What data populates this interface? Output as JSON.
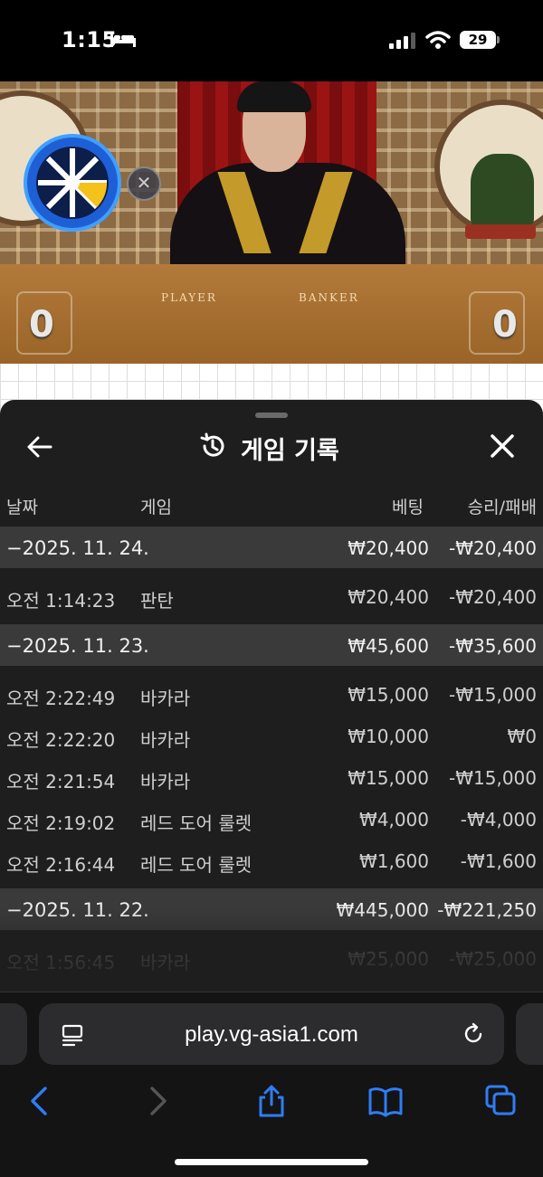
{
  "status_bar": {
    "time": "1:15",
    "battery": "29"
  },
  "video": {
    "player_label": "PLAYER",
    "banker_label": "BANKER",
    "player_score": "0",
    "banker_score": "0"
  },
  "sheet": {
    "title": "게임 기록",
    "columns": {
      "date": "날짜",
      "game": "게임",
      "bet": "베팅",
      "win_loss": "승리/패배"
    },
    "groups": [
      {
        "date": "−2025. 11. 24.",
        "bet": "₩20,400",
        "win_loss": "-₩20,400",
        "rows": [
          {
            "time": "오전 1:14:23",
            "game": "판탄",
            "bet": "₩20,400",
            "win_loss": "-₩20,400"
          }
        ]
      },
      {
        "date": "−2025. 11. 23.",
        "bet": "₩45,600",
        "win_loss": "-₩35,600",
        "rows": [
          {
            "time": "오전 2:22:49",
            "game": "바카라",
            "bet": "₩15,000",
            "win_loss": "-₩15,000"
          },
          {
            "time": "오전 2:22:20",
            "game": "바카라",
            "bet": "₩10,000",
            "win_loss": "₩0"
          },
          {
            "time": "오전 2:21:54",
            "game": "바카라",
            "bet": "₩15,000",
            "win_loss": "-₩15,000"
          },
          {
            "time": "오전 2:19:02",
            "game": "레드 도어 룰렛",
            "bet": "₩4,000",
            "win_loss": "-₩4,000"
          },
          {
            "time": "오전 2:16:44",
            "game": "레드 도어 룰렛",
            "bet": "₩1,600",
            "win_loss": "-₩1,600"
          }
        ]
      },
      {
        "date": "−2025. 11. 22.",
        "bet": "₩445,000",
        "win_loss": "-₩221,250",
        "rows": [
          {
            "time": "오전 1:56:45",
            "game": "바카라",
            "bet": "₩25,000",
            "win_loss": "-₩25,000"
          }
        ]
      }
    ]
  },
  "browser": {
    "url": "play.vg-asia1.com"
  },
  "colors": {
    "sheet_bg": "#1e1e1e",
    "date_row_bg": "#3a3a3a",
    "accent_blue": "#2f7df6"
  }
}
